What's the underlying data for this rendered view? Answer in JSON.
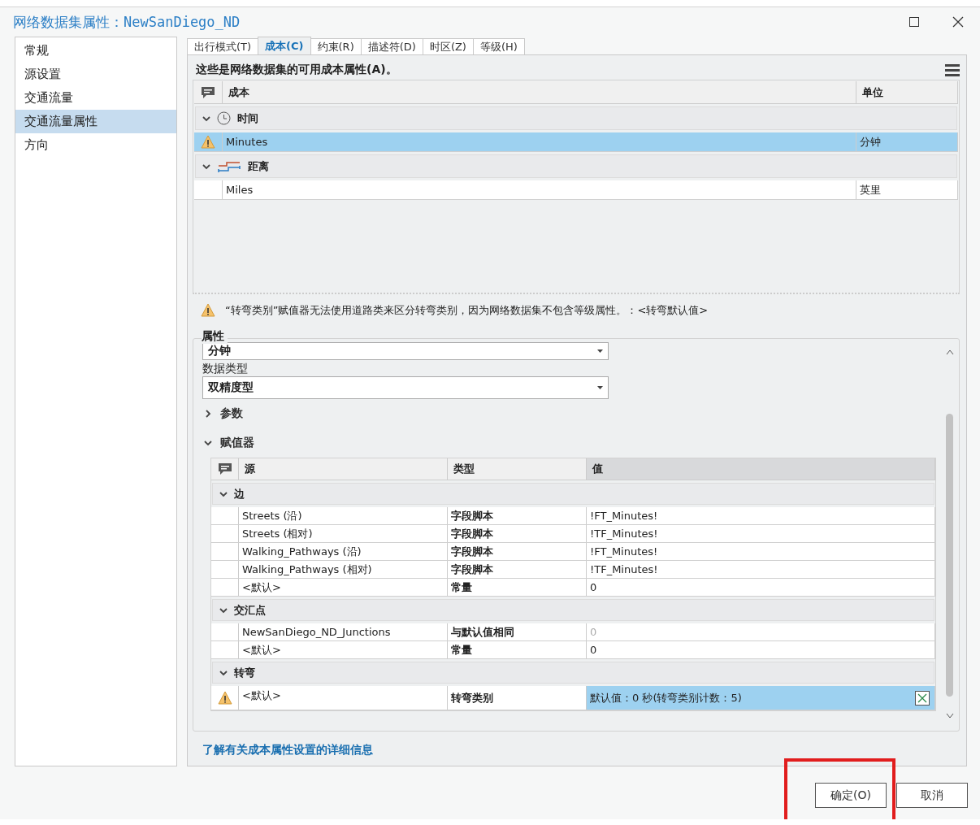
{
  "window": {
    "title": "网络数据集属性：NewSanDiego_ND"
  },
  "sidebar": {
    "items": [
      {
        "label": "常规",
        "selected": false
      },
      {
        "label": "源设置",
        "selected": false
      },
      {
        "label": "交通流量",
        "selected": false
      },
      {
        "label": "交通流量属性",
        "selected": true
      },
      {
        "label": "方向",
        "selected": false
      }
    ]
  },
  "tabs": [
    {
      "label": "出行模式(T)",
      "selected": false
    },
    {
      "label": "成本(C)",
      "selected": true
    },
    {
      "label": "约束(R)",
      "selected": false
    },
    {
      "label": "描述符(D)",
      "selected": false
    },
    {
      "label": "时区(Z)",
      "selected": false
    },
    {
      "label": "等级(H)",
      "selected": false
    }
  ],
  "costs": {
    "caption": "这些是网络数据集的可用成本属性(A)。",
    "columns": [
      "成本",
      "单位"
    ],
    "groups": [
      {
        "label": "时间",
        "kind": "clock",
        "expanded": true,
        "rows": [
          {
            "name": "Minutes",
            "unit": "分钟",
            "warning": true,
            "selected": true
          }
        ]
      },
      {
        "label": "距离",
        "kind": "distance",
        "expanded": true,
        "rows": [
          {
            "name": "Miles",
            "unit": "英里",
            "warning": false,
            "selected": false
          }
        ]
      }
    ]
  },
  "warning": {
    "text": "“转弯类别”赋值器无法使用道路类来区分转弯类别，因为网络数据集不包含等级属性。：<转弯默认值>"
  },
  "properties": {
    "title": "属性",
    "units_value": "分钟",
    "data_type_label": "数据类型",
    "data_type_value": "双精度型",
    "sections": [
      {
        "label": "参数",
        "expanded": false
      },
      {
        "label": "赋值器",
        "expanded": true
      }
    ],
    "evaluators": {
      "columns": [
        "源",
        "类型",
        "值"
      ],
      "groups": [
        {
          "label": "边",
          "expanded": true,
          "rows": [
            {
              "source": "Streets (沿)",
              "type": "字段脚本",
              "value": "!FT_Minutes!",
              "dimmed": false,
              "warning": false,
              "selected": false
            },
            {
              "source": "Streets (相对)",
              "type": "字段脚本",
              "value": "!TF_Minutes!",
              "dimmed": false,
              "warning": false,
              "selected": false
            },
            {
              "source": "Walking_Pathways (沿)",
              "type": "字段脚本",
              "value": "!FT_Minutes!",
              "dimmed": false,
              "warning": false,
              "selected": false
            },
            {
              "source": "Walking_Pathways (相对)",
              "type": "字段脚本",
              "value": "!TF_Minutes!",
              "dimmed": false,
              "warning": false,
              "selected": false
            },
            {
              "source": "<默认>",
              "type": "常量",
              "value": "0",
              "dimmed": false,
              "warning": false,
              "selected": false
            }
          ]
        },
        {
          "label": "交汇点",
          "expanded": true,
          "rows": [
            {
              "source": "NewSanDiego_ND_Junctions",
              "type": "与默认值相同",
              "value": "0",
              "dimmed": true,
              "warning": false,
              "selected": false
            },
            {
              "source": "<默认>",
              "type": "常量",
              "value": "0",
              "dimmed": false,
              "warning": false,
              "selected": false
            }
          ]
        },
        {
          "label": "转弯",
          "expanded": true,
          "rows": [
            {
              "source": "<默认>",
              "type": "转弯类别",
              "value": "默认值：0 秒(转弯类别计数：5)",
              "dimmed": false,
              "warning": true,
              "selected": true
            }
          ]
        }
      ]
    }
  },
  "help_link": "了解有关成本属性设置的详细信息",
  "buttons": [
    {
      "label": "确定(O)",
      "highlighted": true
    },
    {
      "label": "取消",
      "highlighted": false
    }
  ]
}
